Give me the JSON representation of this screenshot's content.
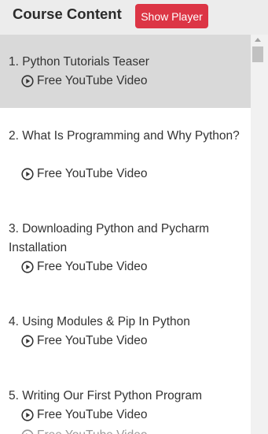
{
  "header": {
    "title": "Course Content",
    "show_player_label": "Show Player"
  },
  "colors": {
    "accent": "#dc3545",
    "header_bg": "#ececec",
    "active_item_bg": "#d9d9d9"
  },
  "lessons": [
    {
      "title": "1. Python Tutorials Teaser",
      "subtitle": "Free YouTube Video",
      "icon": "play-circle-icon",
      "active": true
    },
    {
      "title": "2. What Is Programming and Why Python?",
      "subtitle": "Free YouTube Video",
      "icon": "play-circle-icon",
      "active": false
    },
    {
      "title": "3. Downloading Python and Pycharm Installation",
      "subtitle": "Free YouTube Video",
      "icon": "play-circle-icon",
      "active": false
    },
    {
      "title": "4. Using Modules & Pip In Python",
      "subtitle": "Free YouTube Video",
      "icon": "play-circle-icon",
      "active": false
    },
    {
      "title": "5. Writing Our First Python Program",
      "subtitle": "Free YouTube Video",
      "icon": "play-circle-icon",
      "active": false
    },
    {
      "subtitle": "Free YouTube Video",
      "icon": "play-circle-icon",
      "active": false
    }
  ]
}
